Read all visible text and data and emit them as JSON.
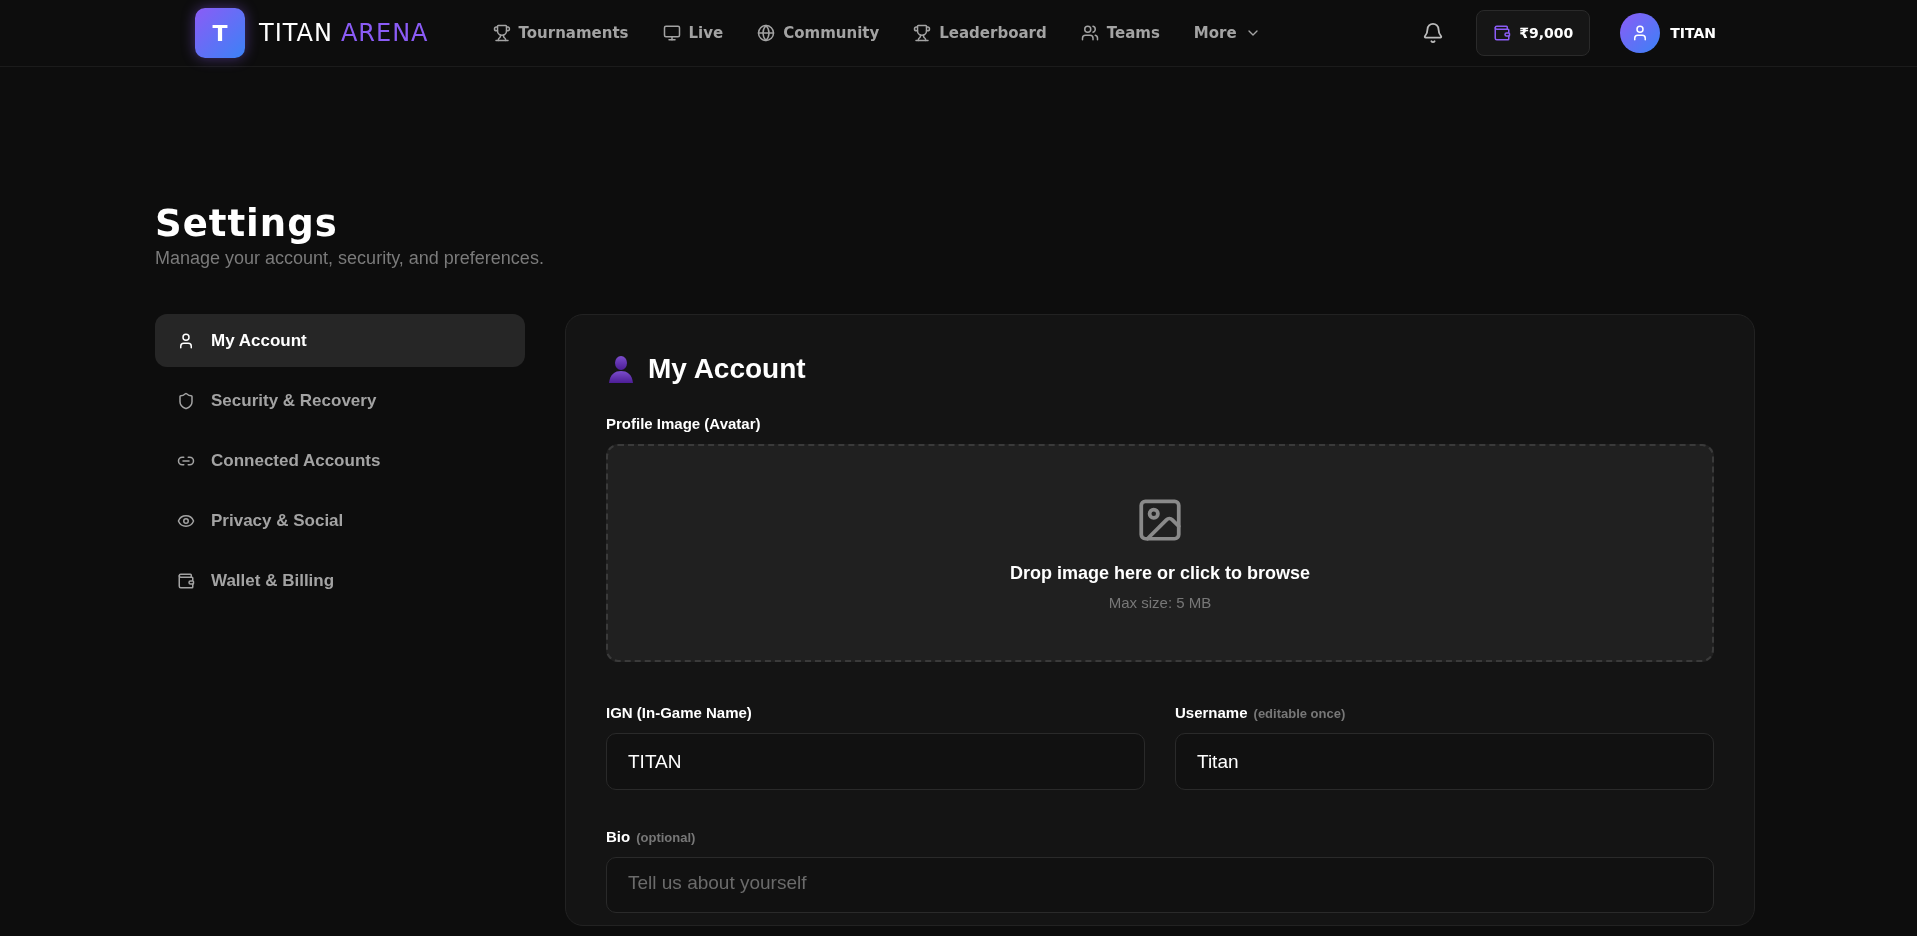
{
  "header": {
    "logo_mark": "T",
    "brand": "TITAN",
    "brand_accent": "ARENA",
    "nav": [
      {
        "label": "Tournaments",
        "kind": "link"
      },
      {
        "label": "Live",
        "kind": "link"
      },
      {
        "label": "Community",
        "kind": "link"
      },
      {
        "label": "Leaderboard",
        "kind": "link"
      },
      {
        "label": "Teams",
        "kind": "link"
      },
      {
        "label": "More",
        "kind": "dropdown"
      }
    ],
    "wallet": "₹9,000",
    "user": "TITAN"
  },
  "page": {
    "title": "Settings",
    "subtitle": "Manage your account, security, and preferences."
  },
  "sidebar": {
    "items": [
      {
        "label": "My Account",
        "selected": true
      },
      {
        "label": "Security & Recovery",
        "selected": false
      },
      {
        "label": "Connected Accounts",
        "selected": false
      },
      {
        "label": "Privacy & Social",
        "selected": false
      },
      {
        "label": "Wallet & Billing",
        "selected": false
      }
    ]
  },
  "panel": {
    "title": "My Account",
    "avatar": {
      "label": "Profile Image (Avatar)",
      "prompt": "Drop image here or click to browse",
      "limit": "Max size: 5 MB"
    },
    "fields": [
      {
        "label": "IGN (In-Game Name)",
        "value": "TITAN"
      },
      {
        "label": "Username",
        "hint": "(editable once)",
        "value": "Titan"
      }
    ],
    "bio": {
      "label": "Bio",
      "hint": "(optional)",
      "placeholder": "Tell us about yourself"
    }
  }
}
